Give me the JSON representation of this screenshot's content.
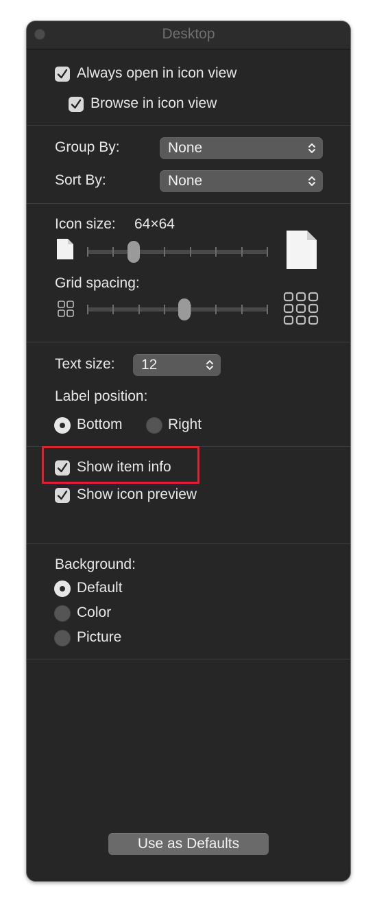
{
  "window": {
    "title": "Desktop"
  },
  "view_options": {
    "always_open_icon_view": {
      "label": "Always open in icon view",
      "checked": true
    },
    "browse_icon_view": {
      "label": "Browse in icon view",
      "checked": true
    }
  },
  "grouping": {
    "group_by_label": "Group By:",
    "group_by_value": "None",
    "sort_by_label": "Sort By:",
    "sort_by_value": "None"
  },
  "icon_size": {
    "label": "Icon size:",
    "value_text": "64×64",
    "level": 0.24
  },
  "grid_spacing": {
    "label": "Grid spacing:",
    "level": 0.54
  },
  "text": {
    "text_size_label": "Text size:",
    "text_size_value": "12",
    "label_position_label": "Label position:",
    "positions": [
      {
        "label": "Bottom",
        "selected": true
      },
      {
        "label": "Right",
        "selected": false
      }
    ]
  },
  "info": {
    "show_item_info": {
      "label": "Show item info",
      "checked": true
    },
    "show_icon_preview": {
      "label": "Show icon preview",
      "checked": true
    }
  },
  "background": {
    "label": "Background:",
    "options": [
      {
        "label": "Default",
        "selected": true
      },
      {
        "label": "Color",
        "selected": false
      },
      {
        "label": "Picture",
        "selected": false
      }
    ]
  },
  "footer": {
    "defaults_button": "Use as Defaults"
  },
  "colors": {
    "highlight": "#e0202e",
    "window_bg": "#262626"
  }
}
